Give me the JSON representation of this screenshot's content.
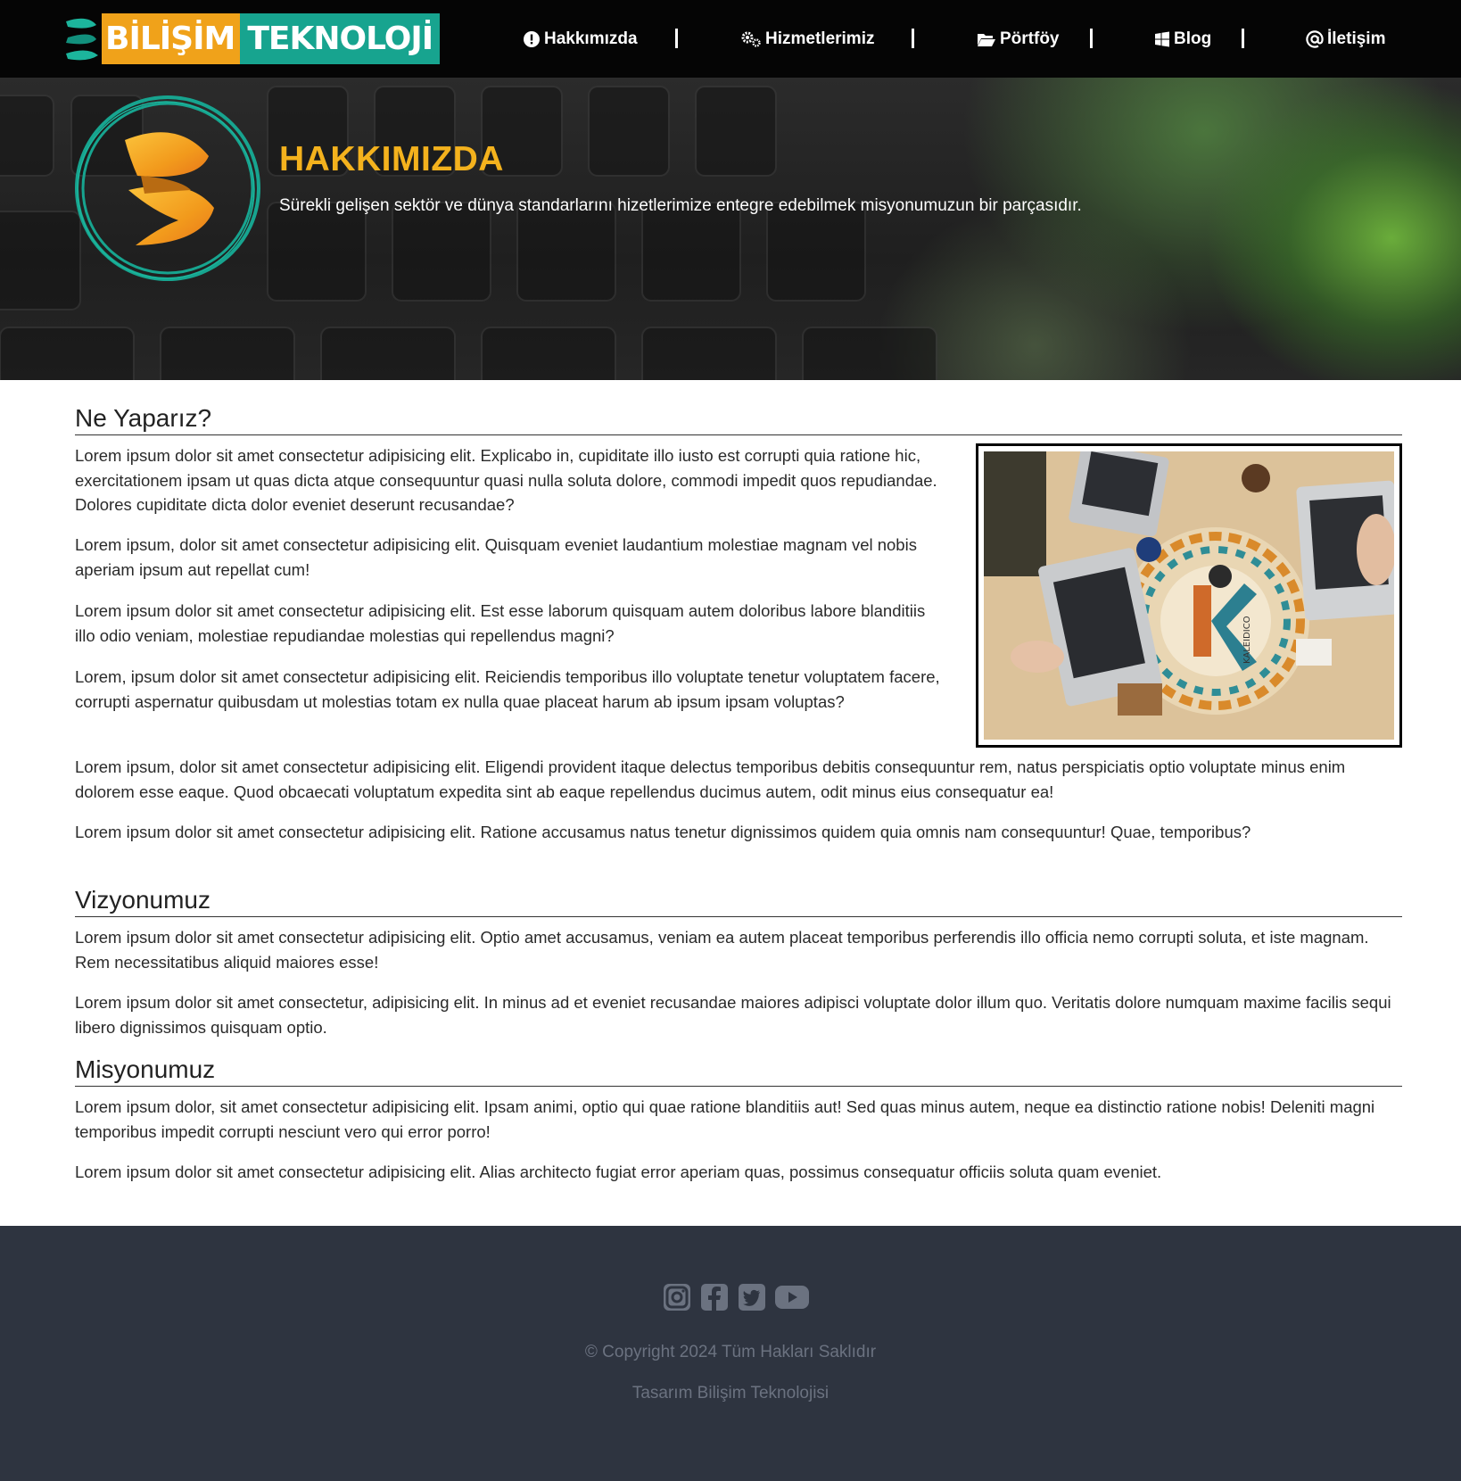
{
  "nav": {
    "brand_part1": "BİLİŞİM",
    "brand_part2": "TEKNOLOJİ",
    "items": [
      {
        "label": "Hakkımızda",
        "icon": "exclamation-circle-icon"
      },
      {
        "label": "Hizmetlerimiz",
        "icon": "gears-icon"
      },
      {
        "label": "Pörtföy",
        "icon": "folder-open-icon"
      },
      {
        "label": "Blog",
        "icon": "windows-icon"
      },
      {
        "label": "İletişim",
        "icon": "at-icon"
      }
    ]
  },
  "hero": {
    "title": "HAKKIMIZDA",
    "subtitle": "Sürekli gelişen sektör ve dünya standarlarını hizetlerimize entegre edebilmek misyonumuzun bir parçasıdır."
  },
  "sections": [
    {
      "heading": "Ne Yaparız?",
      "paragraphs": [
        "Lorem ipsum dolor sit amet consectetur adipisicing elit. Explicabo in, cupiditate illo iusto est corrupti quia ratione hic, exercitationem ipsam ut quas dicta atque consequuntur quasi nulla soluta dolore, commodi impedit quos repudiandae. Dolores cupiditate dicta dolor eveniet deserunt recusandae?",
        "Lorem ipsum, dolor sit amet consectetur adipisicing elit. Quisquam eveniet laudantium molestiae magnam vel nobis aperiam ipsum aut repellat cum!",
        "Lorem ipsum dolor sit amet consectetur adipisicing elit. Est esse laborum quisquam autem doloribus labore blanditiis illo odio veniam, molestiae repudiandae molestias qui repellendus magni?",
        "Lorem, ipsum dolor sit amet consectetur adipisicing elit. Reiciendis temporibus illo voluptate tenetur voluptatem facere, corrupti aspernatur quibusdam ut molestias totam ex nulla quae placeat harum ab ipsum ipsam voluptas?",
        "Lorem ipsum, dolor sit amet consectetur adipisicing elit. Eligendi provident itaque delectus temporibus debitis consequuntur rem, natus perspiciatis optio voluptate minus enim dolorem esse eaque. Quod obcaecati voluptatum expedita sint ab eaque repellendus ducimus autem, odit minus eius consequatur ea!",
        "Lorem ipsum dolor sit amet consectetur adipisicing elit. Ratione accusamus natus tenetur dignissimos quidem quia omnis nam consequuntur! Quae, temporibus?"
      ]
    },
    {
      "heading": "Vizyonumuz",
      "paragraphs": [
        "Lorem ipsum dolor sit amet consectetur adipisicing elit. Optio amet accusamus, veniam ea autem placeat temporibus perferendis illo officia nemo corrupti soluta, et iste magnam. Rem necessitatibus aliquid maiores esse!",
        "Lorem ipsum dolor sit amet consectetur, adipisicing elit. In minus ad et eveniet recusandae maiores adipisci voluptate dolor illum quo. Veritatis dolore numquam maxime facilis sequi libero dignissimos quisquam optio."
      ]
    },
    {
      "heading": "Misyonumuz",
      "paragraphs": [
        "Lorem ipsum dolor, sit amet consectetur adipisicing elit. Ipsam animi, optio qui quae ratione blanditiis aut! Sed quas minus autem, neque ea distinctio ratione nobis! Deleniti magni temporibus impedit corrupti nesciunt vero qui error porro!",
        "Lorem ipsum dolor sit amet consectetur adipisicing elit. Alias architecto fugiat error aperiam quas, possimus consequatur officiis soluta quam eveniet."
      ]
    }
  ],
  "photo": {
    "icon": "team-laptops-photo",
    "caption_text": "KALEIDICO"
  },
  "footer": {
    "social": [
      "instagram-icon",
      "facebook-icon",
      "twitter-icon",
      "youtube-icon"
    ],
    "copyright": "© Copyright 2024 Tüm Hakları Saklıdır",
    "design": "Tasarım Bilişim Teknolojisi"
  },
  "colors": {
    "nav_bg": "#050505",
    "accent_orange": "#f4b21d",
    "accent_teal": "#17a48f",
    "footer_bg": "#2e3440",
    "footer_text": "#6b7280"
  }
}
